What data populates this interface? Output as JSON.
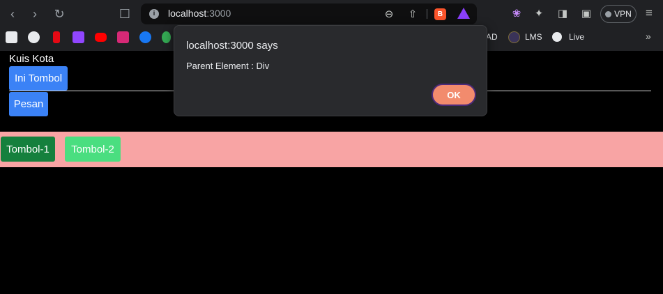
{
  "browser": {
    "url_host": "localhost",
    "url_port": ":3000",
    "vpn_label": "VPN",
    "bookmarks": [
      {
        "label": "AD",
        "icon": "bookmark-ad-icon"
      },
      {
        "label": "LMS",
        "icon": "lms-icon"
      },
      {
        "label": "Live",
        "icon": "live-icon"
      }
    ],
    "more_label": "»",
    "colors": {
      "chrome": "#202124",
      "urlbar": "#0f0f10",
      "brave": "#fb542b"
    }
  },
  "page": {
    "title": "Kuis Kota",
    "button_ini_tombol": "Ini Tombol",
    "button_pesan": "Pesan",
    "button_tombol_1": "Tombol-1",
    "button_tombol_2": "Tombol-2",
    "colors": {
      "blue": "#3b82f6",
      "pink_band": "#f8a4a4",
      "green_dark": "#15803d",
      "green_light": "#4ade80"
    }
  },
  "dialog": {
    "title": "localhost:3000 says",
    "message": "Parent Element : Div",
    "ok_label": "OK",
    "colors": {
      "bg": "#292a2d",
      "ok": "#f28b6d"
    }
  }
}
